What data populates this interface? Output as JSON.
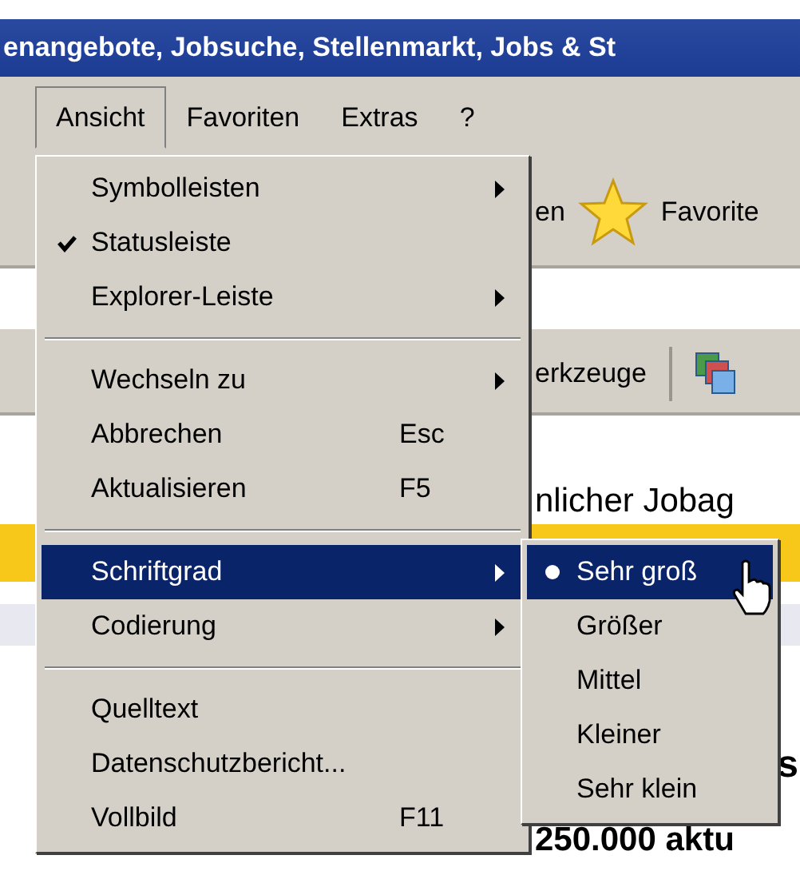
{
  "window": {
    "title": "enangebote, Jobsuche, Stellenmarkt, Jobs & St"
  },
  "menu_bar": [
    {
      "label": "Ansicht",
      "selected": true
    },
    {
      "label": "Favoriten",
      "selected": false
    },
    {
      "label": "Extras",
      "selected": false
    },
    {
      "label": "?",
      "selected": false
    }
  ],
  "toolbar": {
    "button_text": "en",
    "favorites_label": "Favorite"
  },
  "links_bar": {
    "label": "erkzeuge"
  },
  "page": {
    "heading": "nlicher Jobag",
    "letter": "s",
    "count_text": "250.000 aktu"
  },
  "menu": {
    "sections": [
      {
        "items": [
          {
            "label": "Symbolleisten",
            "checked": false,
            "submenu": true,
            "selected": false
          },
          {
            "label": "Statusleiste",
            "checked": true,
            "submenu": false,
            "selected": false
          },
          {
            "label": "Explorer-Leiste",
            "checked": false,
            "submenu": true,
            "selected": false
          }
        ]
      },
      {
        "items": [
          {
            "label": "Wechseln zu",
            "checked": false,
            "submenu": true,
            "selected": false
          },
          {
            "label": "Abbrechen",
            "shortcut": "Esc",
            "checked": false,
            "submenu": false,
            "selected": false
          },
          {
            "label": "Aktualisieren",
            "shortcut": "F5",
            "checked": false,
            "submenu": false,
            "selected": false
          }
        ]
      },
      {
        "items": [
          {
            "label": "Schriftgrad",
            "checked": false,
            "submenu": true,
            "selected": true
          },
          {
            "label": "Codierung",
            "checked": false,
            "submenu": true,
            "selected": false
          }
        ]
      },
      {
        "items": [
          {
            "label": "Quelltext",
            "checked": false,
            "submenu": false,
            "selected": false
          },
          {
            "label": "Datenschutzbericht...",
            "checked": false,
            "submenu": false,
            "selected": false
          },
          {
            "label": "Vollbild",
            "shortcut": "F11",
            "checked": false,
            "submenu": false,
            "selected": false
          }
        ]
      }
    ]
  },
  "submenu": {
    "items": [
      {
        "label": "Sehr groß",
        "checked": true,
        "selected": true
      },
      {
        "label": "Größer",
        "checked": false,
        "selected": false
      },
      {
        "label": "Mittel",
        "checked": false,
        "selected": false
      },
      {
        "label": "Kleiner",
        "checked": false,
        "selected": false
      },
      {
        "label": "Sehr klein",
        "checked": false,
        "selected": false
      }
    ]
  }
}
